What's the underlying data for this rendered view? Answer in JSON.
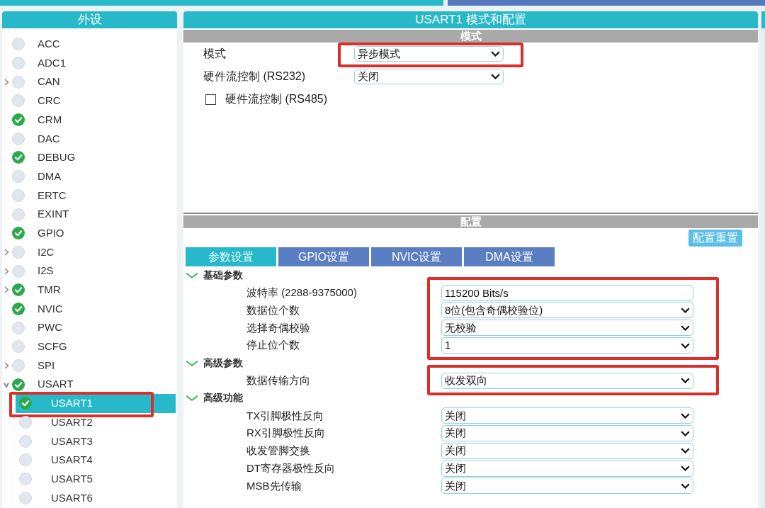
{
  "top_tabs": [
    {
      "selected": true
    },
    {
      "selected": false
    }
  ],
  "sidebar": {
    "title": "外设",
    "items": [
      {
        "label": "ACC",
        "kind": "leaf",
        "enabled": false,
        "selected": false
      },
      {
        "label": "ADC1",
        "kind": "leaf",
        "enabled": false,
        "selected": false
      },
      {
        "label": "CAN",
        "kind": "group",
        "expanded": false,
        "enabled": false,
        "selected": false
      },
      {
        "label": "CRC",
        "kind": "leaf",
        "enabled": false,
        "selected": false
      },
      {
        "label": "CRM",
        "kind": "leaf",
        "enabled": true,
        "selected": false
      },
      {
        "label": "DAC",
        "kind": "leaf",
        "enabled": false,
        "selected": false
      },
      {
        "label": "DEBUG",
        "kind": "leaf",
        "enabled": true,
        "selected": false
      },
      {
        "label": "DMA",
        "kind": "leaf",
        "enabled": false,
        "selected": false
      },
      {
        "label": "ERTC",
        "kind": "leaf",
        "enabled": false,
        "selected": false
      },
      {
        "label": "EXINT",
        "kind": "leaf",
        "enabled": false,
        "selected": false
      },
      {
        "label": "GPIO",
        "kind": "leaf",
        "enabled": true,
        "selected": false
      },
      {
        "label": "I2C",
        "kind": "group",
        "expanded": false,
        "enabled": false,
        "selected": false
      },
      {
        "label": "I2S",
        "kind": "group",
        "expanded": false,
        "enabled": false,
        "selected": false
      },
      {
        "label": "TMR",
        "kind": "group",
        "expanded": false,
        "enabled": true,
        "selected": false
      },
      {
        "label": "NVIC",
        "kind": "leaf",
        "enabled": true,
        "selected": false
      },
      {
        "label": "PWC",
        "kind": "leaf",
        "enabled": false,
        "selected": false
      },
      {
        "label": "SCFG",
        "kind": "leaf",
        "enabled": false,
        "selected": false
      },
      {
        "label": "SPI",
        "kind": "group",
        "expanded": false,
        "enabled": false,
        "selected": false
      },
      {
        "label": "USART",
        "kind": "group",
        "expanded": true,
        "enabled": true,
        "selected": false,
        "children": [
          {
            "label": "USART1",
            "enabled": true,
            "selected": true,
            "highlighted": true
          },
          {
            "label": "USART2",
            "enabled": false,
            "selected": false,
            "highlighted": false
          },
          {
            "label": "USART3",
            "enabled": false,
            "selected": false,
            "highlighted": false
          },
          {
            "label": "USART4",
            "enabled": false,
            "selected": false,
            "highlighted": false
          },
          {
            "label": "USART5",
            "enabled": false,
            "selected": false,
            "highlighted": false
          },
          {
            "label": "USART6",
            "enabled": false,
            "selected": false,
            "highlighted": false
          }
        ]
      }
    ]
  },
  "panel": {
    "title": "USART1 模式和配置",
    "mode": {
      "title": "模式",
      "rows": [
        {
          "kind": "select",
          "label": "模式",
          "value": "异步模式",
          "highlighted": true
        },
        {
          "kind": "select",
          "label": "硬件流控制 (RS232)",
          "value": "关闭",
          "highlighted": false
        },
        {
          "kind": "checkbox",
          "label": "硬件流控制 (RS485)",
          "checked": false
        }
      ]
    },
    "config": {
      "title": "配置",
      "reset_button": "配置重置",
      "tabs": [
        {
          "label": "参数设置",
          "selected": true
        },
        {
          "label": "GPIO设置",
          "selected": false
        },
        {
          "label": "NVIC设置",
          "selected": false
        },
        {
          "label": "DMA设置",
          "selected": false
        }
      ],
      "groups": [
        {
          "title": "基础参数",
          "expanded": true,
          "highlighted": true,
          "params": [
            {
              "label": "波特率 (2288-9375000)",
              "kind": "input",
              "value": "115200 Bits/s"
            },
            {
              "label": "数据位个数",
              "kind": "select",
              "value": "8位(包含奇偶校验位)"
            },
            {
              "label": "选择奇偶校验",
              "kind": "select",
              "value": "无校验"
            },
            {
              "label": "停止位个数",
              "kind": "select",
              "value": "1"
            }
          ]
        },
        {
          "title": "高级参数",
          "expanded": true,
          "highlighted": true,
          "params": [
            {
              "label": "数据传输方向",
              "kind": "select",
              "value": "收发双向"
            }
          ]
        },
        {
          "title": "高级功能",
          "expanded": true,
          "highlighted": false,
          "params": [
            {
              "label": "TX引脚极性反向",
              "kind": "select",
              "value": "关闭"
            },
            {
              "label": "RX引脚极性反向",
              "kind": "select",
              "value": "关闭"
            },
            {
              "label": "收发管脚交换",
              "kind": "select",
              "value": "关闭"
            },
            {
              "label": "DT寄存器极性反向",
              "kind": "select",
              "value": "关闭"
            },
            {
              "label": "MSB先传输",
              "kind": "select",
              "value": "关闭"
            }
          ]
        }
      ]
    }
  }
}
